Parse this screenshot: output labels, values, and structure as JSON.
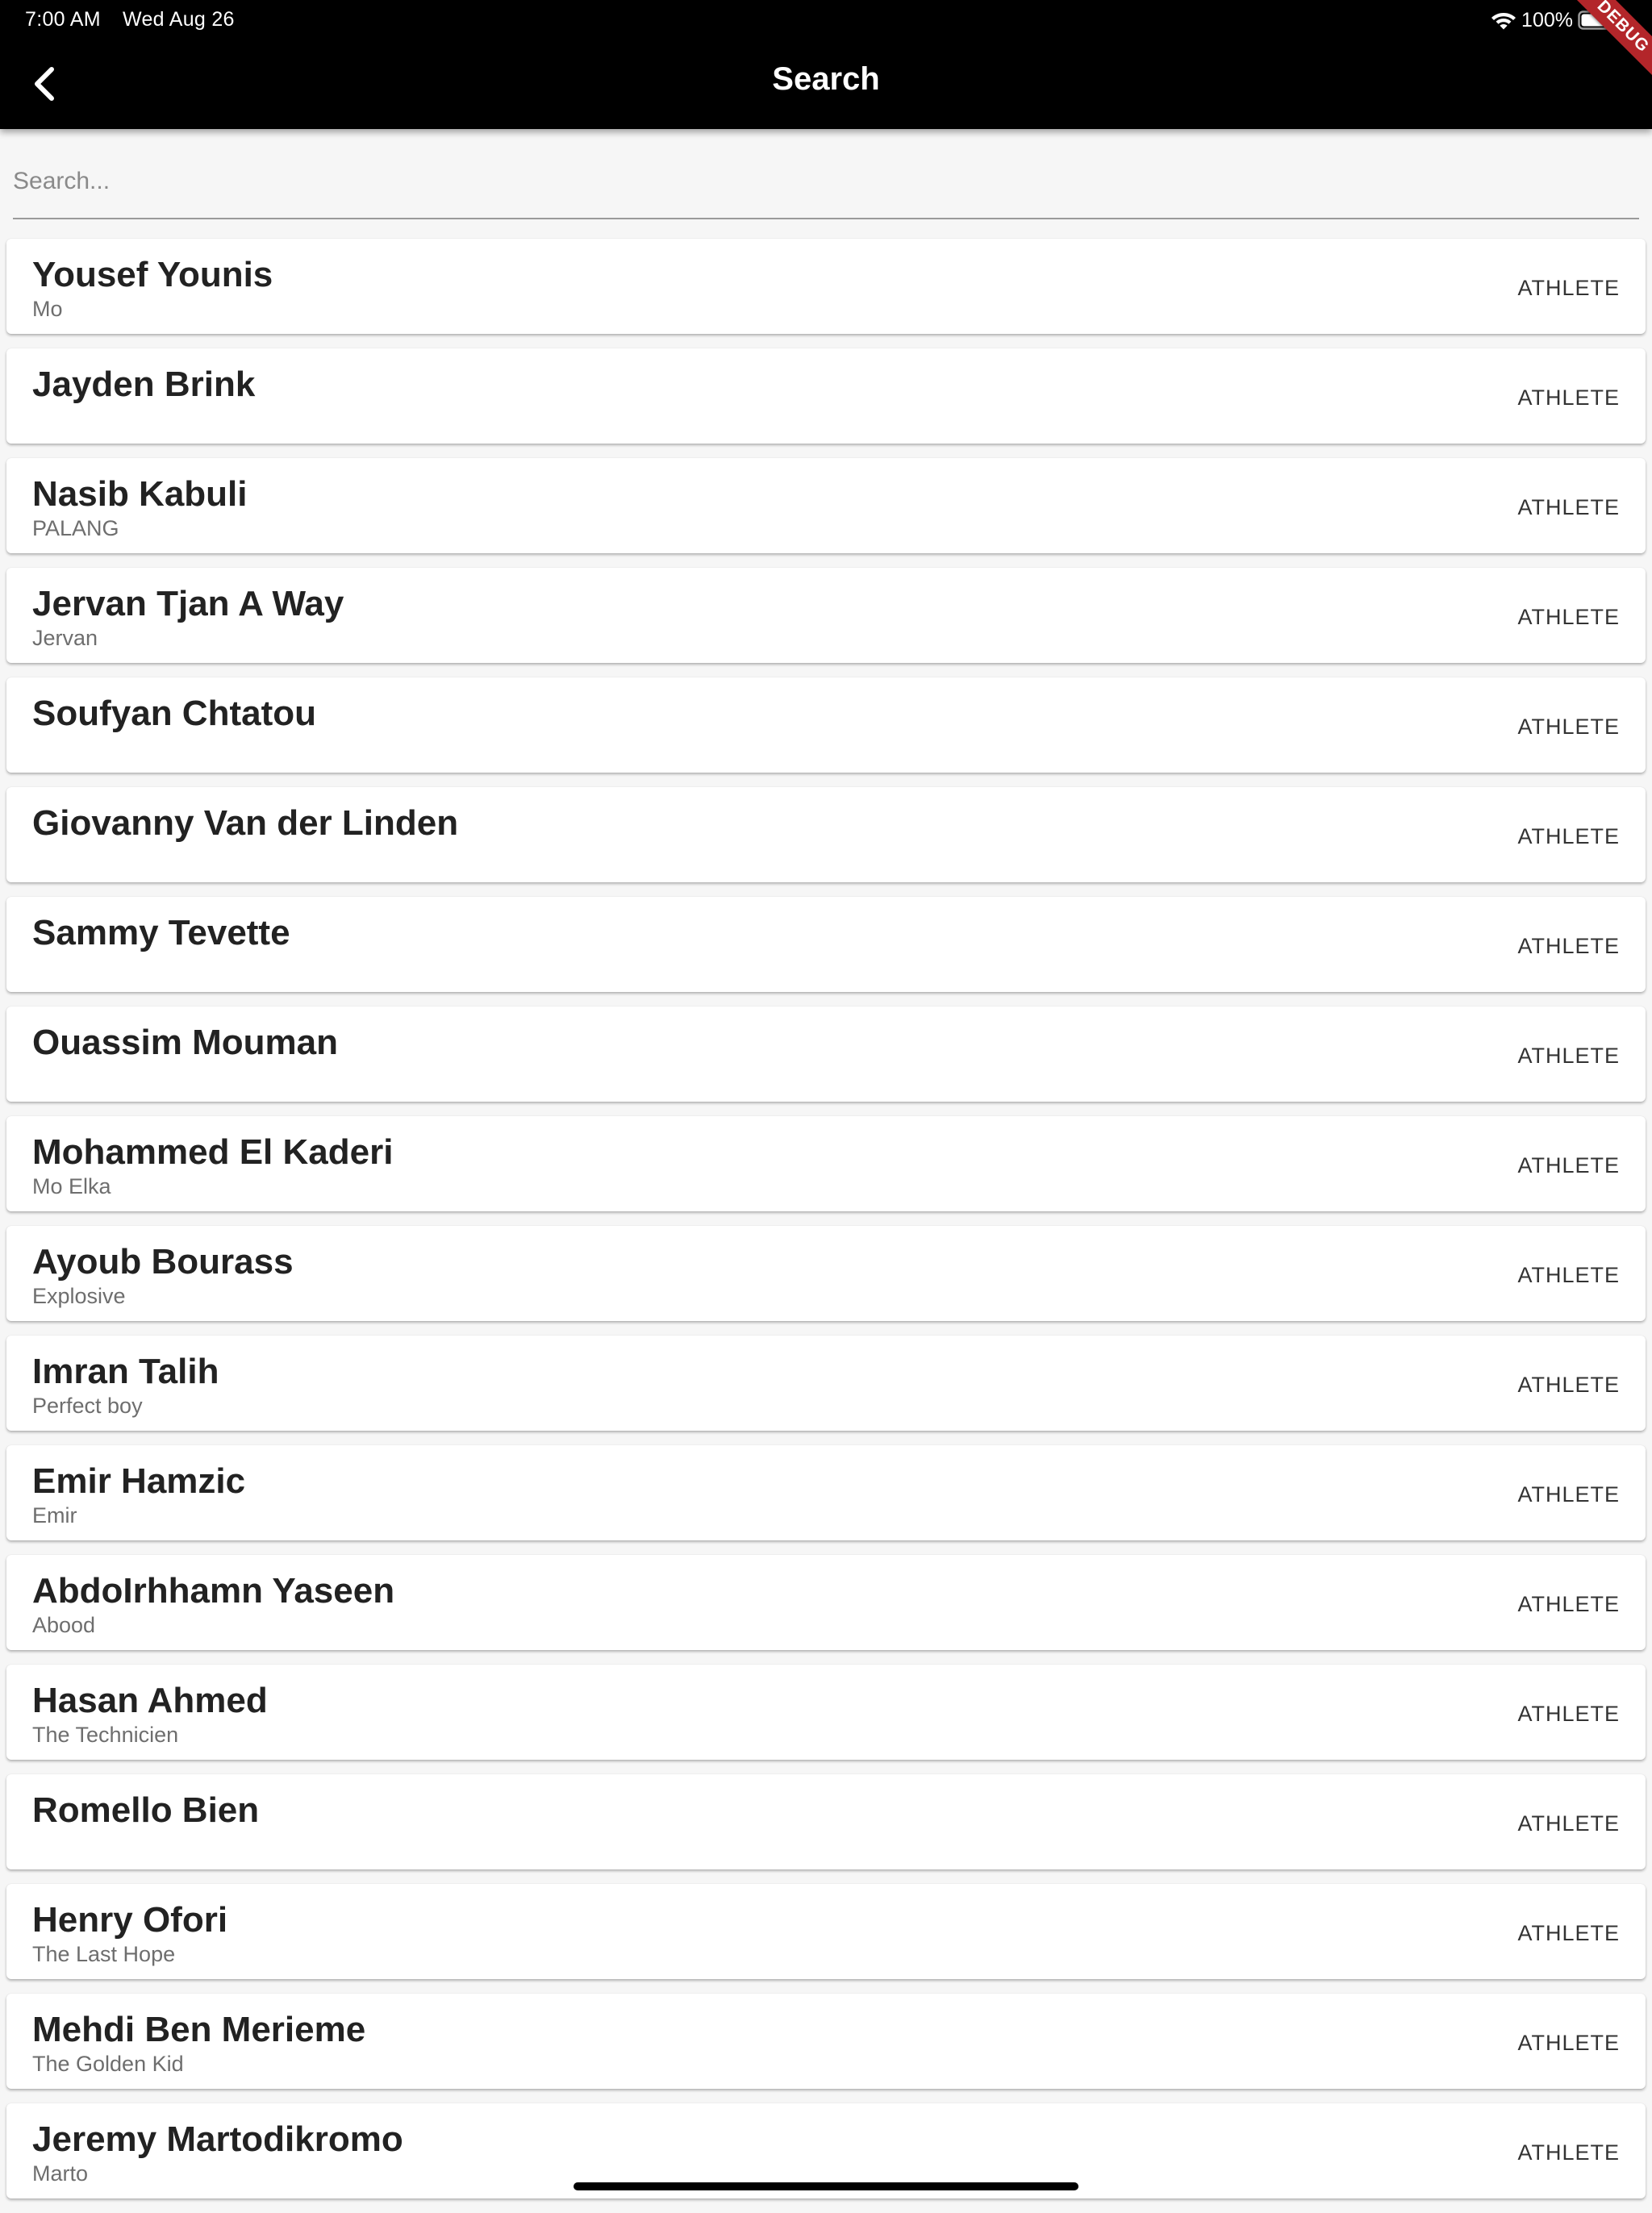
{
  "status_bar": {
    "time": "7:00 AM",
    "date": "Wed Aug 26",
    "battery": "100%"
  },
  "app_bar": {
    "title": "Search",
    "debug_label": "DEBUG"
  },
  "search": {
    "placeholder": "Search...",
    "value": ""
  },
  "results": [
    {
      "name": "Yousef Younis",
      "nickname": "Mo",
      "role": "ATHLETE"
    },
    {
      "name": "Jayden Brink",
      "nickname": "",
      "role": "ATHLETE"
    },
    {
      "name": "Nasib Kabuli",
      "nickname": "PALANG",
      "role": "ATHLETE"
    },
    {
      "name": "Jervan Tjan A Way",
      "nickname": "Jervan",
      "role": "ATHLETE"
    },
    {
      "name": "Soufyan Chtatou",
      "nickname": "",
      "role": "ATHLETE"
    },
    {
      "name": "Giovanny Van der Linden",
      "nickname": "",
      "role": "ATHLETE"
    },
    {
      "name": "Sammy Tevette",
      "nickname": "",
      "role": "ATHLETE"
    },
    {
      "name": "Ouassim Mouman",
      "nickname": "",
      "role": "ATHLETE"
    },
    {
      "name": "Mohammed El Kaderi",
      "nickname": "Mo Elka",
      "role": "ATHLETE"
    },
    {
      "name": "Ayoub Bourass",
      "nickname": "Explosive",
      "role": "ATHLETE"
    },
    {
      "name": "Imran Talih",
      "nickname": "Perfect boy",
      "role": "ATHLETE"
    },
    {
      "name": "Emir Hamzic",
      "nickname": "Emir",
      "role": "ATHLETE"
    },
    {
      "name": "AbdoIrhhamn Yaseen",
      "nickname": "Abood",
      "role": "ATHLETE"
    },
    {
      "name": "Hasan Ahmed",
      "nickname": "The Technicien",
      "role": "ATHLETE"
    },
    {
      "name": "Romello Bien",
      "nickname": "",
      "role": "ATHLETE"
    },
    {
      "name": "Henry Ofori",
      "nickname": "The Last Hope",
      "role": "ATHLETE"
    },
    {
      "name": "Mehdi Ben Merieme",
      "nickname": "The Golden Kid",
      "role": "ATHLETE"
    },
    {
      "name": "Jeremy Martodikromo",
      "nickname": "Marto",
      "role": "ATHLETE"
    }
  ]
}
